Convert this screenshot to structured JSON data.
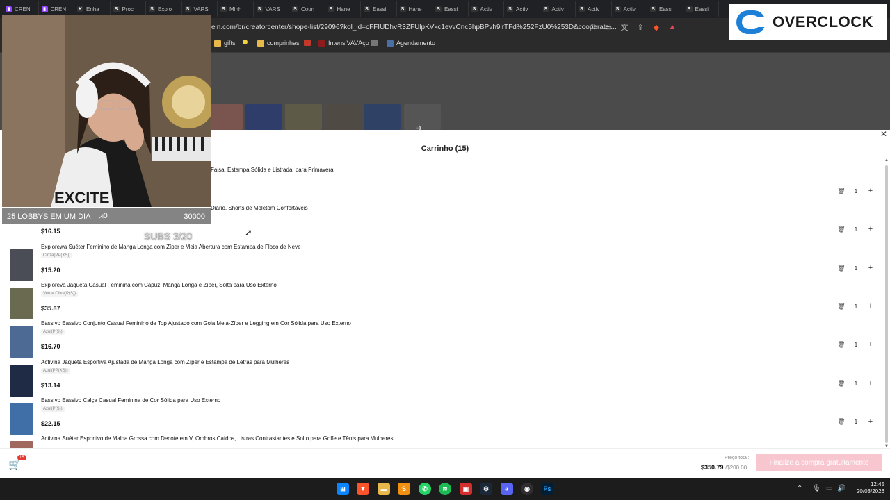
{
  "browser": {
    "tabs": [
      {
        "label": "CREN",
        "icon": "twitch-icon",
        "color": "#9146ff"
      },
      {
        "label": "CREN",
        "icon": "twitch-icon",
        "color": "#9146ff"
      },
      {
        "label": "Enha",
        "icon": "k-icon",
        "color": "#333333"
      },
      {
        "label": "Proc",
        "icon": "shein-icon",
        "color": "#333333"
      },
      {
        "label": "Explo",
        "icon": "shein-icon",
        "color": "#333333"
      },
      {
        "label": "VARS",
        "icon": "shein-icon",
        "color": "#333333"
      },
      {
        "label": "Minh",
        "icon": "shein-icon",
        "color": "#333333"
      },
      {
        "label": "VARS",
        "icon": "shein-icon",
        "color": "#333333"
      },
      {
        "label": "Coun",
        "icon": "shein-icon",
        "color": "#333333"
      },
      {
        "label": "Hane",
        "icon": "shein-icon",
        "color": "#333333"
      },
      {
        "label": "Eassi",
        "icon": "shein-icon",
        "color": "#333333"
      },
      {
        "label": "Hane",
        "icon": "shein-icon",
        "color": "#333333"
      },
      {
        "label": "Eassi",
        "icon": "shein-icon",
        "color": "#333333"
      },
      {
        "label": "Activ",
        "icon": "shein-icon",
        "color": "#333333"
      },
      {
        "label": "Activ",
        "icon": "shein-icon",
        "color": "#333333"
      },
      {
        "label": "Activ",
        "icon": "shein-icon",
        "color": "#333333"
      },
      {
        "label": "Activ",
        "icon": "shein-icon",
        "color": "#333333"
      },
      {
        "label": "Activ",
        "icon": "shein-icon",
        "color": "#333333"
      },
      {
        "label": "Eassi",
        "icon": "shein-icon",
        "color": "#333333"
      },
      {
        "label": "Eassi",
        "icon": "shein-icon",
        "color": "#333333"
      }
    ],
    "url": "ein.com/br/creatorcenter/shope-list/29096?kol_id=cFFIUDhvR3ZFUlpKVkc1evvCnc5hpBPvh9lrTFd%252FzU0%253D&cooperatel...",
    "bookmarks": [
      {
        "label": "gifts",
        "icon": "folder-icon",
        "color": "#e8b84a"
      },
      {
        "label": "",
        "icon": "circle-icon",
        "color": "#f4d03f"
      },
      {
        "label": "comprinhas",
        "icon": "folder-icon",
        "color": "#e8b84a"
      },
      {
        "label": "",
        "icon": "bookmark-icon",
        "color": "#c0392b"
      },
      {
        "label": "IntensiVAVÁço",
        "icon": "bookmark-icon",
        "color": "#8e1b1b"
      },
      {
        "label": "",
        "icon": "v-icon",
        "color": "#777777"
      },
      {
        "label": "Agendamento",
        "icon": "calendar-icon",
        "color": "#4a6fa5"
      }
    ]
  },
  "cart": {
    "title": "Carrinho (15)",
    "items": [
      {
        "title": "Falsa, Estampa Sólida e Listrada, para Primavera",
        "variant": "",
        "price": "",
        "qty": "1"
      },
      {
        "title": "Diário, Shorts de Moletom Confortáveis",
        "variant": "",
        "price": "$16.15",
        "qty": "1"
      },
      {
        "title": "Explorewa Suéter Feminino de Manga Longa com Zíper e Meia Abertura com Estampa de Floco de Neve",
        "variant": "Cinza(PP(XS))",
        "price": "$15.20",
        "qty": "1"
      },
      {
        "title": "Exploreva Jaqueta Casual Feminina com Capuz, Manga Longa e Zíper, Solta para Uso Externo",
        "variant": "Verde Oliva(P(S))",
        "price": "$35.87",
        "qty": "1"
      },
      {
        "title": "Eassivo Eassivo Conjunto Casual Feminino de Top Ajustado com Gola Meia-Zíper e Legging em Cor Sólida para Uso Externo",
        "variant": "Azul(P(S))",
        "price": "$16.70",
        "qty": "1"
      },
      {
        "title": "Activina Jaqueta Esportiva Ajustada de Manga Longa com Zíper e Estampa de Letras para Mulheres",
        "variant": "Azul(PP(XS))",
        "price": "$13.14",
        "qty": "1"
      },
      {
        "title": "Eassivo Eassivo Calça Casual Feminina de Cor Sólida para Uso Externo",
        "variant": "Azul(P(S))",
        "price": "$22.15",
        "qty": "1"
      },
      {
        "title": "Activina Suéter Esportivo de Malha Grossa com Decote em V, Ombros Caídos, Listras Contrastantes e Solto para Golfe e Tênis para Mulheres",
        "variant": "",
        "price": "",
        "qty": ""
      }
    ],
    "cart_badge": "15",
    "total_label": "Preço total:",
    "total_value": "$350.79",
    "total_limit": "/$200.00",
    "checkout_label": "Finalize a compra gratuitamente"
  },
  "stream": {
    "goal_title": "25 LOBBYS EM UM DIA",
    "goal_count": "0",
    "goal_target": "30000",
    "subs_label": "SUBS 3/20",
    "logo_text": "OVERCLOCK",
    "brand_color": "#1e7fd6"
  },
  "taskbar": {
    "time": "12:45",
    "date": "20/03/2026"
  }
}
